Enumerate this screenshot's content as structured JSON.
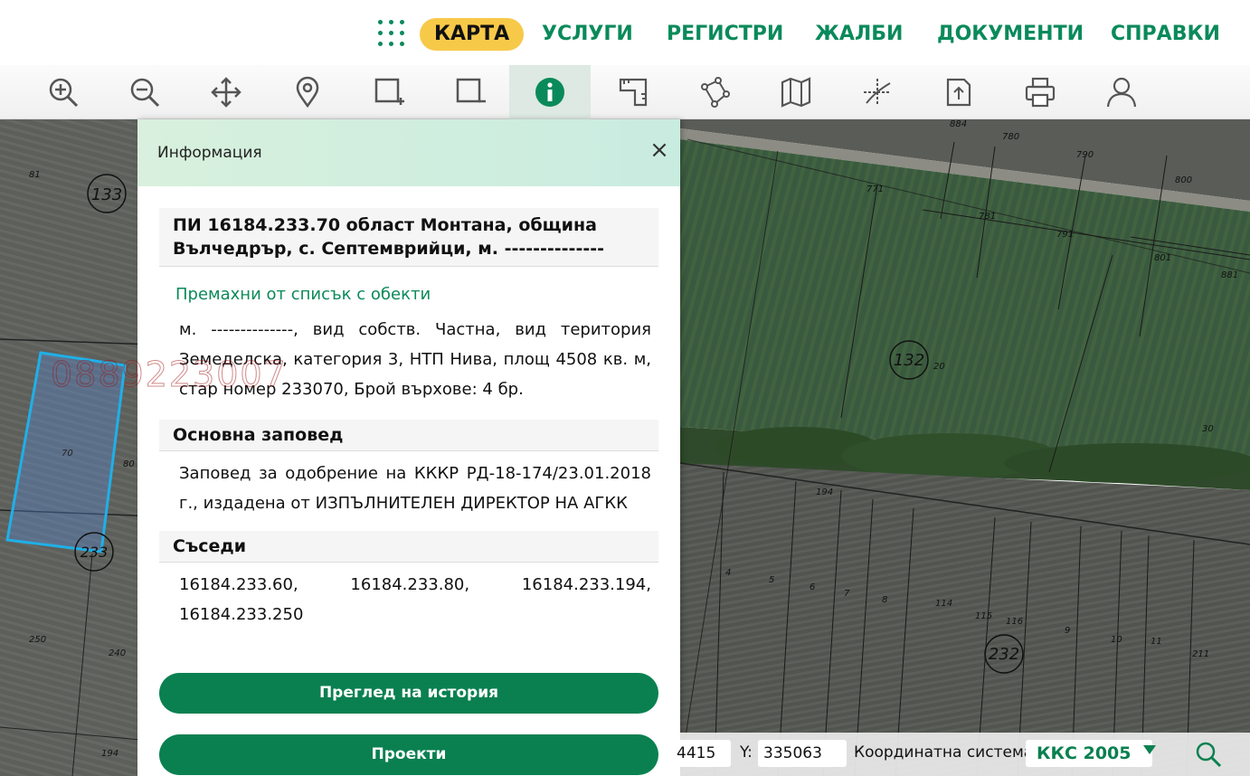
{
  "nav": {
    "items": [
      "КАРТА",
      "УСЛУГИ",
      "РЕГИСТРИ",
      "ЖАЛБИ",
      "ДОКУМЕНТИ",
      "СПРАВКИ"
    ],
    "active": "КАРТА"
  },
  "toolbar": {
    "tools": [
      "zoom-in-icon",
      "zoom-out-icon",
      "pan-icon",
      "location-pin-icon",
      "select-add-icon",
      "select-remove-icon",
      "info-icon",
      "measure-icon",
      "draw-polygon-icon",
      "map-layers-icon",
      "coordinates-icon",
      "export-icon",
      "print-icon",
      "user-icon"
    ],
    "active": "info-icon"
  },
  "map": {
    "parcel_labels": [
      "81",
      "133",
      "80",
      "70",
      "233",
      "250",
      "240",
      "194",
      "884",
      "780",
      "790",
      "800",
      "771",
      "781",
      "791",
      "801",
      "881",
      "132",
      "20",
      "30",
      "194",
      "4",
      "5",
      "6",
      "7",
      "8",
      "114",
      "115",
      "116",
      "9",
      "10",
      "11",
      "211",
      "232"
    ]
  },
  "panel": {
    "title": "Информация",
    "object_heading": "ПИ 16184.233.70 област Монтана, община Вълчедрър, с. Септемврийци, м. --------------",
    "remove_link": "Премахни от списък с обекти",
    "description": "м. --------------, вид собств. Частна, вид територия Земеделска, категория 3, НТП Нива, площ 4508 кв. м, стар номер 233070, Брой върхове: 4 бр.",
    "order_heading": "Основна заповед",
    "order_text": "Заповед за одобрение на КККР РД-18-174/23.01.2018 г., издадена от ИЗПЪЛНИТЕЛЕН ДИРЕКТОР НА АГКК",
    "neighbors_heading": "Съседи",
    "neighbors": [
      "16184.233.60,",
      "16184.233.80,",
      "16184.233.194,",
      "16184.233.250"
    ],
    "history_button": "Преглед на история",
    "projects_button": "Проекти",
    "watermark": "0889223007"
  },
  "bottombar": {
    "x_value": "4415",
    "y_label": "Y:",
    "y_value": "335063",
    "cs_label": "Координатна система:",
    "cs_value": "ККС 2005"
  },
  "colors": {
    "accent": "#0a8a5a",
    "active_nav": "#f7c948",
    "parcel_highlight": "#1fb0e8"
  }
}
